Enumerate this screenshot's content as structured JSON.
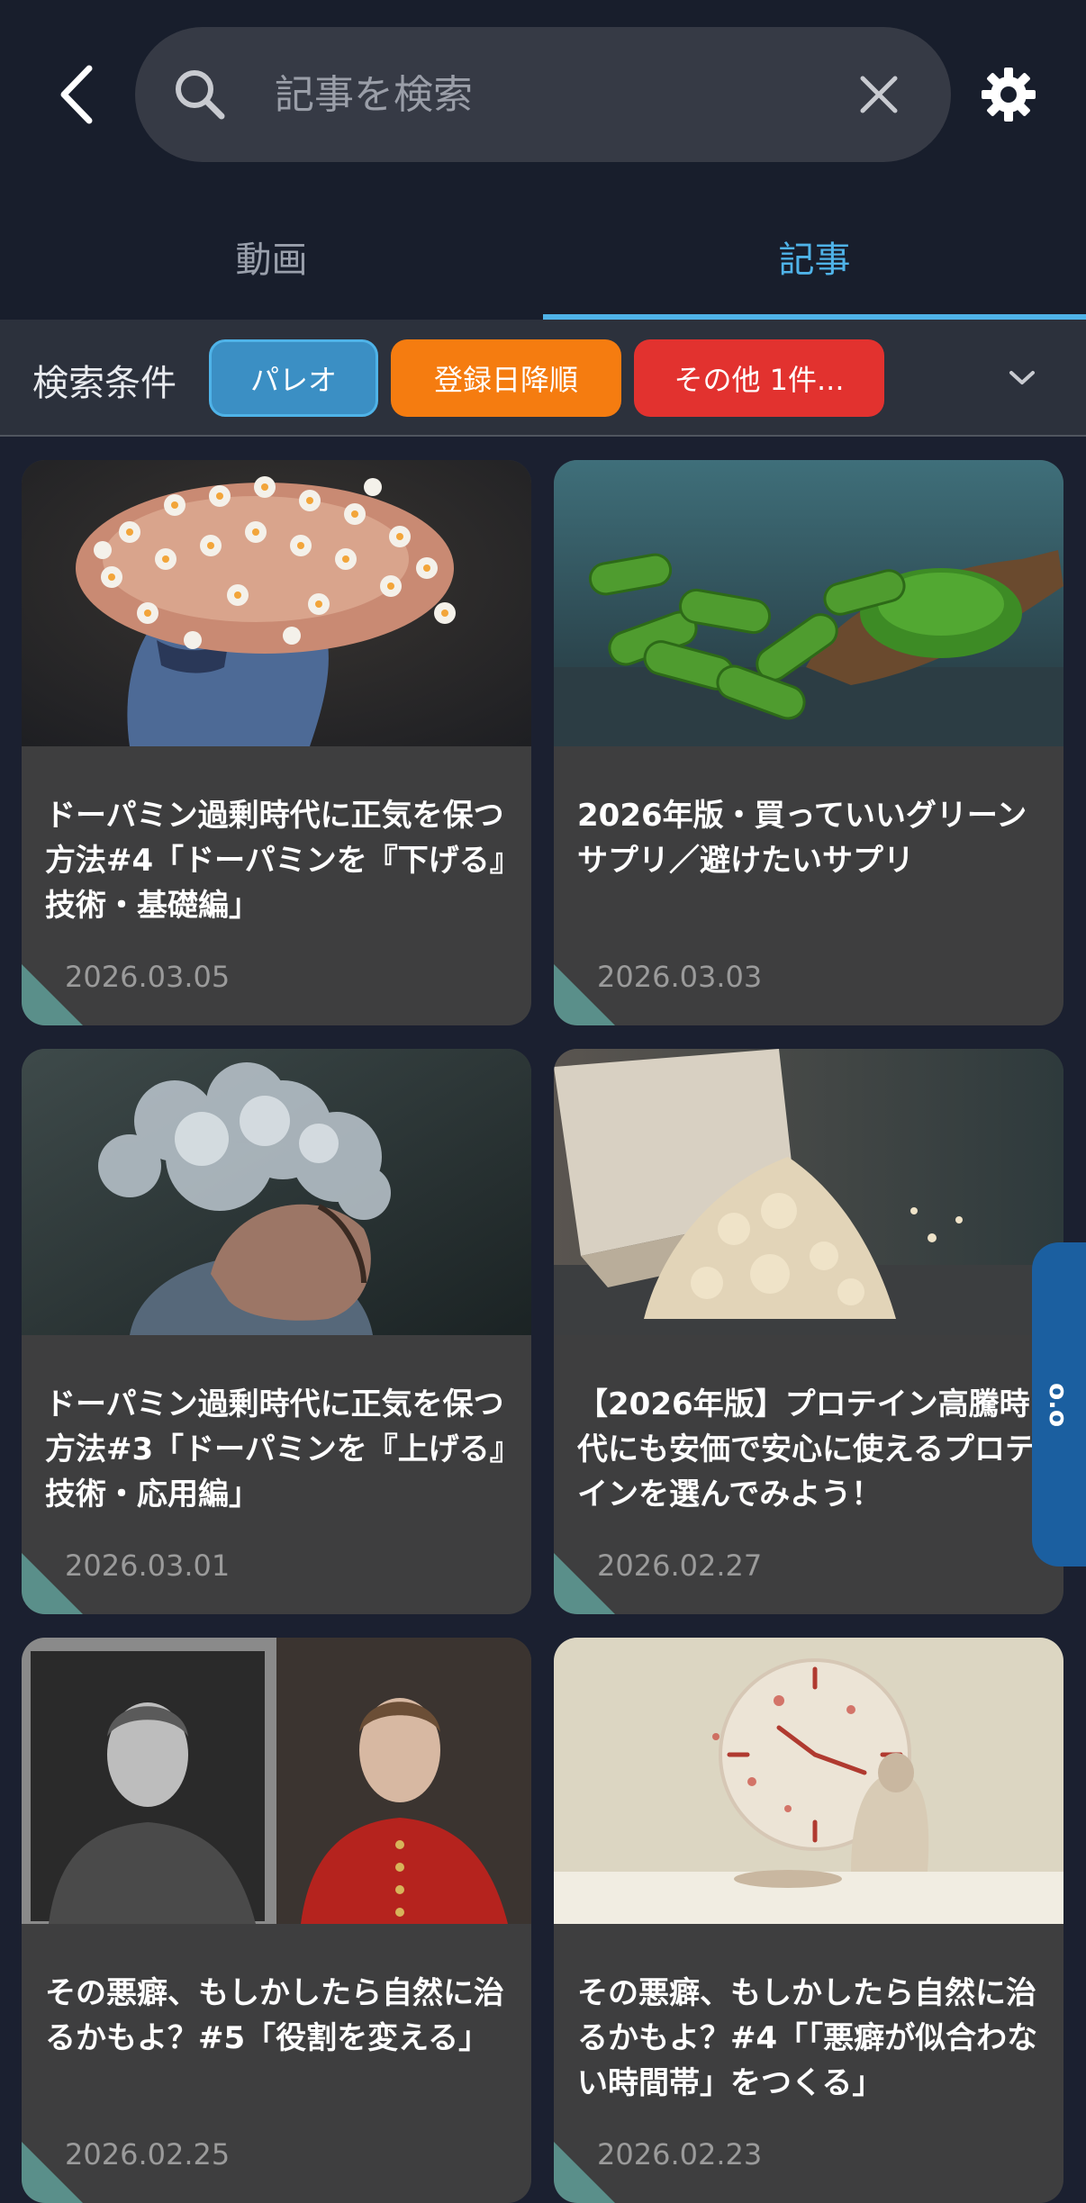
{
  "header": {
    "search_placeholder": "記事を検索"
  },
  "tabs": [
    {
      "label": "動画",
      "active": false
    },
    {
      "label": "記事",
      "active": true
    }
  ],
  "filter": {
    "label": "検索条件",
    "chips": [
      {
        "label": "パレオ",
        "color": "#3b8fc4"
      },
      {
        "label": "登録日降順",
        "color": "#f57c10"
      },
      {
        "label": "その他 1件...",
        "color": "#e2322f"
      }
    ]
  },
  "side_tab": {
    "label": "o.o"
  },
  "articles": [
    {
      "title": "ドーパミン過剰時代に正気を保つ方法#4「ドーパミンを『下げる』技術・基礎編」",
      "date": "2026.03.05",
      "thumbnail": "brain-flowers"
    },
    {
      "title": "2026年版・買っていいグリーンサプリ／避けたいサプリ",
      "date": "2026.03.03",
      "thumbnail": "green-capsules"
    },
    {
      "title": "ドーパミン過剰時代に正気を保つ方法#3「ドーパミンを『上げる』技術・応用編」",
      "date": "2026.03.01",
      "thumbnail": "man-smoke-head"
    },
    {
      "title": "【2026年版】プロテイン高騰時代にも安価で安心に使えるプロテインを選んでみよう！",
      "date": "2026.02.27",
      "thumbnail": "protein-powder"
    },
    {
      "title": "その悪癖、もしかしたら自然に治るかもよ？#5「役割を変える」",
      "date": "2026.02.25",
      "thumbnail": "two-boys-uniform"
    },
    {
      "title": "その悪癖、もしかしたら自然に治るかもよ？#4「「悪癖が似合わない時間帯」をつくる」",
      "date": "2026.02.23",
      "thumbnail": "clock-wall"
    }
  ]
}
